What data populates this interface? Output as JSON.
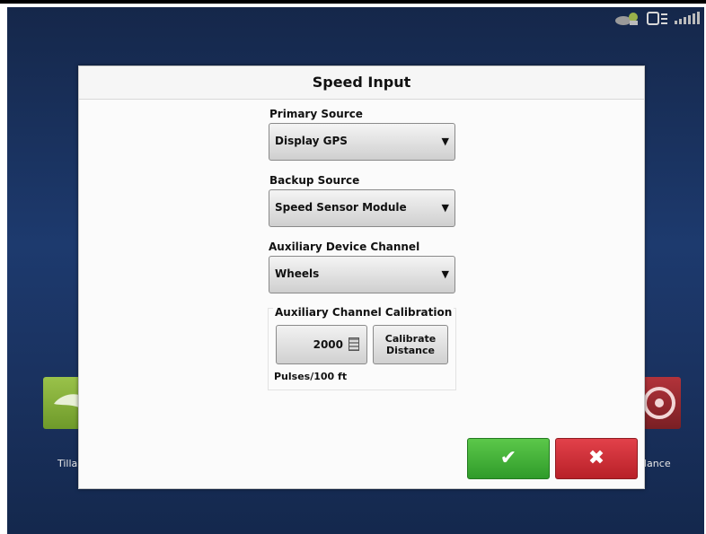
{
  "dialog": {
    "title": "Speed Input",
    "primary_source": {
      "label": "Primary Source",
      "value": "Display GPS"
    },
    "backup_source": {
      "label": "Backup Source",
      "value": "Speed Sensor Module"
    },
    "aux_channel": {
      "label": "Auxiliary Device Channel",
      "value": "Wheels"
    },
    "calibration": {
      "title": "Auxiliary Channel Calibration",
      "value": "2000",
      "button_label": "Calibrate Distance",
      "units": "Pulses/100 ft"
    },
    "ok_symbol": "✔",
    "cancel_symbol": "✖"
  },
  "background": {
    "left_tile_label": "Tilla",
    "right_tile_label": "lance"
  },
  "icons": {
    "dropdown_arrow": "▼",
    "status": [
      "gps-icon",
      "display-icon",
      "signal-icon"
    ]
  },
  "colors": {
    "ok": "#3aa832",
    "cancel": "#c8262e",
    "background": "#1d3a6e"
  }
}
